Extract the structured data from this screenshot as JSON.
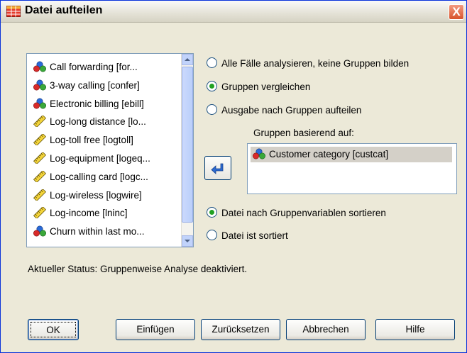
{
  "window": {
    "title": "Datei aufteilen",
    "close_label": "X"
  },
  "variable_list": {
    "items": [
      {
        "label": "Call forwarding [for...",
        "icon": "nominal-variable-icon"
      },
      {
        "label": "3-way calling [confer]",
        "icon": "nominal-variable-icon"
      },
      {
        "label": "Electronic billing [ebill]",
        "icon": "nominal-variable-icon"
      },
      {
        "label": "Log-long distance [lo...",
        "icon": "scale-variable-icon"
      },
      {
        "label": "Log-toll free [logtoll]",
        "icon": "scale-variable-icon"
      },
      {
        "label": "Log-equipment [logeq...",
        "icon": "scale-variable-icon"
      },
      {
        "label": "Log-calling card [logc...",
        "icon": "scale-variable-icon"
      },
      {
        "label": "Log-wireless [logwire]",
        "icon": "scale-variable-icon"
      },
      {
        "label": "Log-income [lninc]",
        "icon": "scale-variable-icon"
      },
      {
        "label": "Churn within last mo...",
        "icon": "nominal-variable-icon"
      }
    ]
  },
  "analysis_options": {
    "selected": "compare",
    "options": [
      {
        "id": "all",
        "label": "Alle Fälle analysieren, keine Gruppen bilden"
      },
      {
        "id": "compare",
        "label": "Gruppen vergleichen"
      },
      {
        "id": "organize",
        "label": "Ausgabe nach Gruppen aufteilen"
      }
    ]
  },
  "groups": {
    "label": "Gruppen basierend auf:",
    "items": [
      "Customer category [custcat]"
    ]
  },
  "sort_options": {
    "selected": "sort",
    "options": [
      {
        "id": "sort",
        "label": "Datei nach Gruppenvariablen sortieren"
      },
      {
        "id": "sorted",
        "label": "Datei ist sortiert"
      }
    ]
  },
  "status_text": "Aktueller Status: Gruppenweise Analyse deaktiviert.",
  "buttons": {
    "ok": "OK",
    "paste": "Einfügen",
    "reset": "Zurücksetzen",
    "cancel": "Abbrechen",
    "help": "Hilfe"
  },
  "colors": {
    "title_bar": "#e4e2d6",
    "dialog_bg": "#ece9d8",
    "radio_selected": "#21a121",
    "close_button": "#d8532c"
  }
}
